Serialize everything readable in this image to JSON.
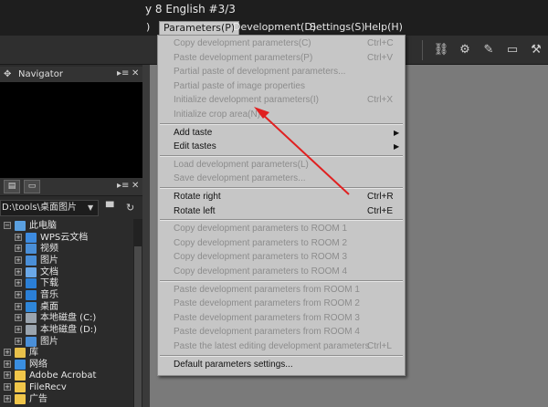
{
  "window": {
    "title": "y 8 English  #3/3"
  },
  "menubar": {
    "lead": ")",
    "items": [
      {
        "label": "Parameters(P)",
        "active": true
      },
      {
        "label": "Development(D)"
      },
      {
        "label": "Settings(S)"
      },
      {
        "label": "Help(H)"
      }
    ]
  },
  "navigator": {
    "title": "Navigator"
  },
  "browser": {
    "path": "D:\\tools\\桌面图片",
    "tree": [
      {
        "label": "此电脑",
        "icon": "computer-icon",
        "color": "#5aa0e0",
        "level": 0,
        "expander": "−"
      },
      {
        "label": "WPS云文档",
        "icon": "cloud-icon",
        "color": "#3d8be0",
        "level": 1,
        "expander": "+"
      },
      {
        "label": "视频",
        "icon": "video-icon",
        "color": "#4a8fd8",
        "level": 1,
        "expander": "+"
      },
      {
        "label": "图片",
        "icon": "pictures-icon",
        "color": "#4a8fd8",
        "level": 1,
        "expander": "+"
      },
      {
        "label": "文档",
        "icon": "documents-icon",
        "color": "#6aa8e8",
        "level": 1,
        "expander": "+"
      },
      {
        "label": "下载",
        "icon": "download-icon",
        "color": "#2b7fd6",
        "level": 1,
        "expander": "+"
      },
      {
        "label": "音乐",
        "icon": "music-icon",
        "color": "#2b7fd6",
        "level": 1,
        "expander": "+"
      },
      {
        "label": "桌面",
        "icon": "desktop-icon",
        "color": "#2f86d8",
        "level": 1,
        "expander": "+"
      },
      {
        "label": "本地磁盘 (C:)",
        "icon": "drive-icon",
        "color": "#9aa4ae",
        "level": 1,
        "expander": "+"
      },
      {
        "label": "本地磁盘 (D:)",
        "icon": "drive-icon",
        "color": "#9aa4ae",
        "level": 1,
        "expander": "+"
      },
      {
        "label": "图片",
        "icon": "pictures-icon",
        "color": "#4a8fd8",
        "level": 1,
        "expander": "+"
      },
      {
        "label": "库",
        "icon": "library-icon",
        "color": "#e8c04a",
        "level": 0,
        "expander": "+"
      },
      {
        "label": "网络",
        "icon": "network-icon",
        "color": "#3a8ee0",
        "level": 0,
        "expander": "+"
      },
      {
        "label": "Adobe Acrobat",
        "icon": "folder-icon",
        "color": "#f0c64a",
        "level": 0,
        "expander": "+"
      },
      {
        "label": "FileRecv",
        "icon": "folder-icon",
        "color": "#f0c64a",
        "level": 0,
        "expander": "+"
      },
      {
        "label": "广告",
        "icon": "folder-icon",
        "color": "#f0c64a",
        "level": 0,
        "expander": "+"
      }
    ]
  },
  "dropdown": {
    "items": [
      {
        "type": "item",
        "label": "Copy development parameters(C)",
        "shortcut": "Ctrl+C",
        "enabled": false
      },
      {
        "type": "item",
        "label": "Paste development parameters(P)",
        "shortcut": "Ctrl+V",
        "enabled": false
      },
      {
        "type": "item",
        "label": "Partial paste of development parameters...",
        "shortcut": "",
        "enabled": false
      },
      {
        "type": "item",
        "label": "Partial paste of image properties",
        "shortcut": "",
        "enabled": false
      },
      {
        "type": "item",
        "label": "Initialize development parameters(I)",
        "shortcut": "Ctrl+X",
        "enabled": false
      },
      {
        "type": "item",
        "label": "Initialize crop area(N)",
        "shortcut": "",
        "enabled": false
      },
      {
        "type": "sep"
      },
      {
        "type": "item",
        "label": "Add taste",
        "shortcut": "",
        "enabled": true,
        "submenu": true
      },
      {
        "type": "item",
        "label": "Edit tastes",
        "shortcut": "",
        "enabled": true,
        "submenu": true
      },
      {
        "type": "sep"
      },
      {
        "type": "item",
        "label": "Load development parameters(L)",
        "shortcut": "",
        "enabled": false
      },
      {
        "type": "item",
        "label": "Save development parameters...",
        "shortcut": "",
        "enabled": false
      },
      {
        "type": "sep"
      },
      {
        "type": "item",
        "label": "Rotate right",
        "shortcut": "Ctrl+R",
        "enabled": true
      },
      {
        "type": "item",
        "label": "Rotate left",
        "shortcut": "Ctrl+E",
        "enabled": true
      },
      {
        "type": "sep"
      },
      {
        "type": "item",
        "label": "Copy development parameters to ROOM 1",
        "shortcut": "",
        "enabled": false
      },
      {
        "type": "item",
        "label": "Copy development parameters to ROOM 2",
        "shortcut": "",
        "enabled": false
      },
      {
        "type": "item",
        "label": "Copy development parameters to ROOM 3",
        "shortcut": "",
        "enabled": false
      },
      {
        "type": "item",
        "label": "Copy development parameters to ROOM 4",
        "shortcut": "",
        "enabled": false
      },
      {
        "type": "sep"
      },
      {
        "type": "item",
        "label": "Paste development parameters from ROOM 1",
        "shortcut": "",
        "enabled": false
      },
      {
        "type": "item",
        "label": "Paste development parameters from ROOM 2",
        "shortcut": "",
        "enabled": false
      },
      {
        "type": "item",
        "label": "Paste development parameters from ROOM 3",
        "shortcut": "",
        "enabled": false
      },
      {
        "type": "item",
        "label": "Paste development parameters from ROOM 4",
        "shortcut": "",
        "enabled": false
      },
      {
        "type": "item",
        "label": "Paste the latest editing development parameters",
        "shortcut": "Ctrl+L",
        "enabled": false
      },
      {
        "type": "sep"
      },
      {
        "type": "item",
        "label": "Default parameters settings...",
        "shortcut": "",
        "enabled": true
      }
    ]
  },
  "colors": {
    "annotation_arrow": "#e02020",
    "menu_bg": "#c6c6c6",
    "canvas_bg": "#7a7a7a"
  }
}
